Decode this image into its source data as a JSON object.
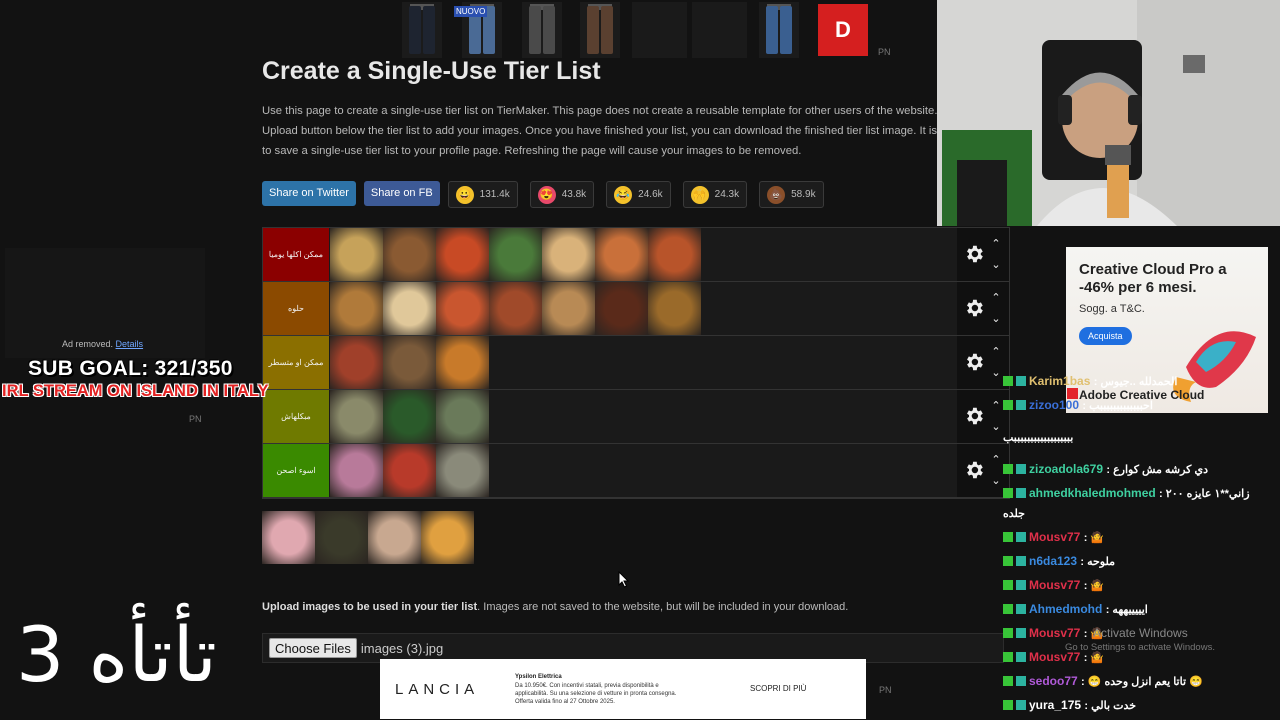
{
  "top_ad": {
    "badge": "NUOVO",
    "brand_letter": "D",
    "label": "PN"
  },
  "page": {
    "title": "Create a Single-Use Tier List",
    "intro_lines": [
      "Use this page to create a single-use tier list on TierMaker. This page does not create a reusable template for other users of the website.",
      "Upload button below the tier list to add your images. Once you have finished your list, you can download the finished tier list image. It is",
      "to save a single-use tier list to your profile page. Refreshing the page will cause your images to be removed."
    ]
  },
  "share": {
    "twitter": "Share on Twitter",
    "fb": "Share on FB",
    "reactions": [
      {
        "icon": "smile-emoji-icon",
        "glyph": "😀",
        "color": "#f4c22b",
        "count": "131.4k"
      },
      {
        "icon": "heart-eyes-emoji-icon",
        "glyph": "😍",
        "color": "#e8496a",
        "count": "43.8k"
      },
      {
        "icon": "laughing-emoji-icon",
        "glyph": "😂",
        "color": "#f4c22b",
        "count": "24.6k"
      },
      {
        "icon": "raised-hands-emoji-icon",
        "glyph": "🙌",
        "color": "#f4c22b",
        "count": "24.3k"
      },
      {
        "icon": "poop-emoji-icon",
        "glyph": "💩",
        "color": "#8a4f2a",
        "count": "58.9k"
      }
    ]
  },
  "tiers": [
    {
      "label": "ممكن اكلها يوميا",
      "color": "#8b0000",
      "items": [
        "#c6a25a",
        "#8a5a32",
        "#c84a25",
        "#4a7a3a",
        "#d9b27a",
        "#c9703a",
        "#b8542a"
      ]
    },
    {
      "label": "حلوه",
      "color": "#8b4a00",
      "items": [
        "#b07a3a",
        "#e0c89a",
        "#c9562f",
        "#a04a2a",
        "#b88a55",
        "#5a2a1a",
        "#9a6a2a"
      ]
    },
    {
      "label": "ممكن او متسطر",
      "color": "#8b6f00",
      "items": [
        "#a0402a",
        "#7a5a3a",
        "#c87a2a"
      ]
    },
    {
      "label": "مبكلهاش",
      "color": "#6f7a00",
      "items": [
        "#8a8a6a",
        "#2a5a2a",
        "#6a7a5a"
      ]
    },
    {
      "label": "اسوء اصحن",
      "color": "#3a8a00",
      "items": [
        "#b87a9a",
        "#b83a2a",
        "#8a8a7a"
      ]
    }
  ],
  "pool_items": [
    "#e0a8b0",
    "#3a3a2a",
    "#c8a890",
    "#e0a040"
  ],
  "upload": {
    "bold": "Upload images to be used in your tier list",
    "text": ". Images are not saved to the website, but will be included in your download.",
    "button": "Choose Files",
    "file": "images (3).jpg"
  },
  "overlay": {
    "ad_removed": "Ad removed.",
    "ad_details": "Details",
    "sub_goal": "SUB GOAL: 321/350",
    "irl": "IRL STREAM ON ISLAND IN ITALY",
    "pn": "PN",
    "arabic_big": "تأتأه 3"
  },
  "bottom_ad": {
    "logo": "LANCIA",
    "model": "Ypsilon Elettrica",
    "desc": "Da 10.950€. Con incentivi statali, previa disponibilità e applicabilità. Su una selezione di vetture in pronta consegna. Offerta valida fino al 27 Ottobre 2025.",
    "cta": "SCOPRI DI PIÙ",
    "pn": "PN"
  },
  "right_ad": {
    "head1": "Creative Cloud Pro a",
    "head2": "-46% per 6 mesi.",
    "sub": "Sogg. a T&C.",
    "button": "Acquista",
    "brand": "Adobe Creative Cloud"
  },
  "chat": [
    {
      "user": "Karim1bas",
      "color": "#e0c070",
      "text": ": الحمدلله ..جيوس"
    },
    {
      "user": "zizoo100",
      "color": "#3a6fd8",
      "text": ": احبببببببببببببب"
    },
    {
      "user": "",
      "color": "#ffffff",
      "text": "ببببببببببببببببببب"
    },
    {
      "user": "zizoadola679",
      "color": "#3fd0a0",
      "text": ": دي كرشه مش كوارع"
    },
    {
      "user": "ahmedkhaledmohmed",
      "color": "#3fd0a0",
      "text": ": زاني**١ عايزه ٢٠٠"
    },
    {
      "user": "",
      "color": "#ffffff",
      "text": "جلده"
    },
    {
      "user": "Mousv77",
      "color": "#e0304a",
      "text": ": 🤷"
    },
    {
      "user": "n6da123",
      "color": "#3a8ae0",
      "text": ": ملوحه"
    },
    {
      "user": "Mousv77",
      "color": "#e0304a",
      "text": ": 🤷"
    },
    {
      "user": "Ahmedmohd",
      "color": "#3a8ae0",
      "text": ": ايييييههه"
    },
    {
      "user": "Mousv77",
      "color": "#e0304a",
      "text": ": 🤷"
    },
    {
      "user": "Mousv77",
      "color": "#e0304a",
      "text": ": 🤷"
    },
    {
      "user": "sedoo77",
      "color": "#b05ad8",
      "text": ": 😁 تاتا يعم انزل وحده 😁"
    },
    {
      "user": "yura_175",
      "color": "#ffffff",
      "text": ": خدت بالي"
    }
  ],
  "windows": {
    "activate": "Activate Windows",
    "activate_sub": "Go to Settings to activate Windows."
  }
}
